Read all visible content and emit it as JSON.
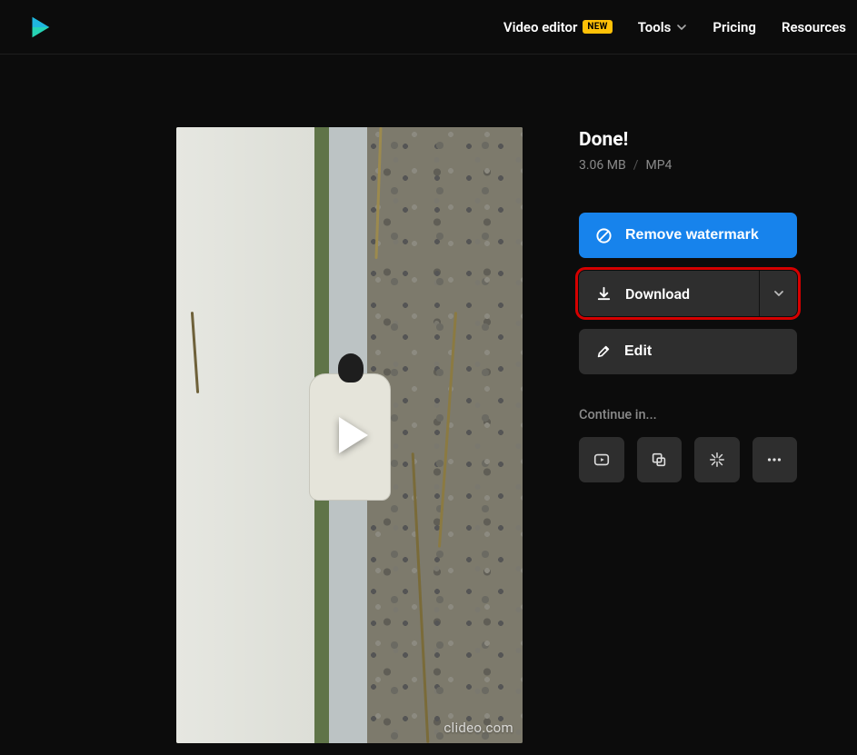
{
  "header": {
    "nav": {
      "video_editor": "Video editor",
      "badge_new": "NEW",
      "tools": "Tools",
      "pricing": "Pricing",
      "resources": "Resources"
    }
  },
  "result": {
    "title": "Done!",
    "size": "3.06 MB",
    "separator": "/",
    "format": "MP4",
    "watermark_brand": "clideo.com"
  },
  "actions": {
    "remove_watermark": "Remove watermark",
    "download": "Download",
    "edit": "Edit"
  },
  "continue": {
    "label": "Continue in..."
  },
  "colors": {
    "primary": "#1783ec",
    "highlight_outline": "#d50000",
    "badge": "#ffc107"
  }
}
